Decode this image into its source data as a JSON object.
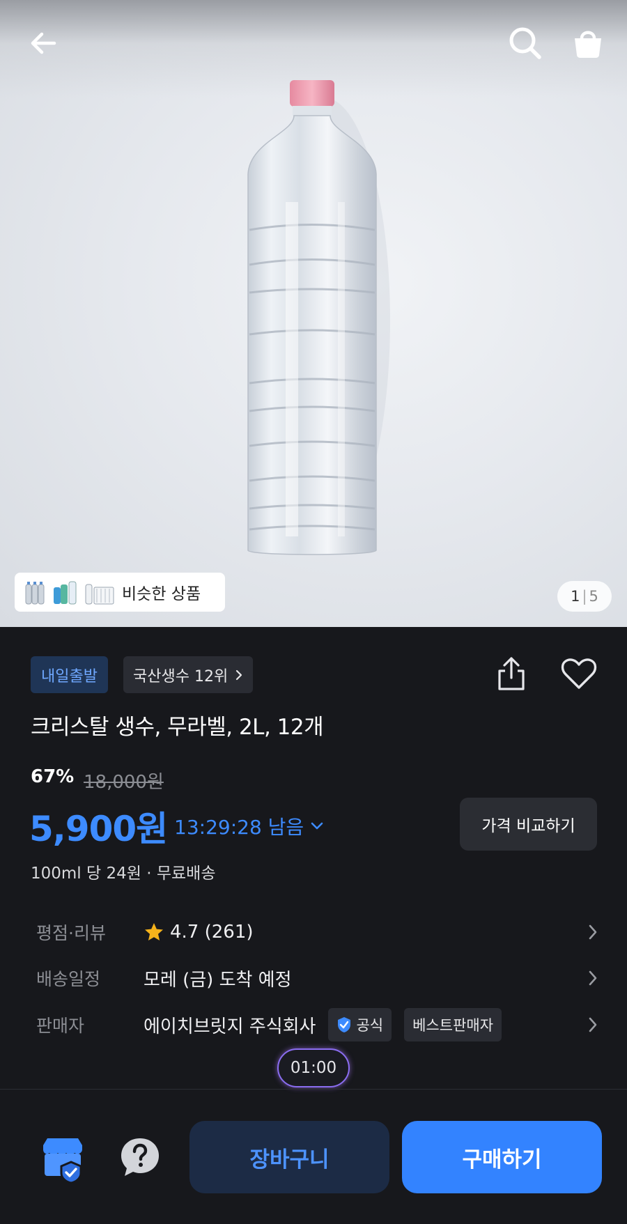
{
  "gallery": {
    "similar_label": "비슷한 상품",
    "page_current": "1",
    "page_total": "5"
  },
  "badges": {
    "delivery": "내일출발",
    "rank": "국산생수 12위"
  },
  "product": {
    "title": "크리스탈 생수, 무라벨, 2L, 12개",
    "discount": "67%",
    "original_price": "18,000원",
    "price": "5,900원",
    "timer": "13:29:28 남음",
    "compare_label": "가격 비교하기",
    "unit_info": "100ml 당 24원 · 무료배송"
  },
  "info": {
    "rating_label": "평점·리뷰",
    "rating_value": "4.7 (261)",
    "delivery_label": "배송일정",
    "delivery_value": "모레 (금) 도착 예정",
    "seller_label": "판매자",
    "seller_value": "에이치브릿지 주식회사",
    "official_tag": "공식",
    "best_tag": "베스트판매자"
  },
  "floating_time": "01:00",
  "actions": {
    "cart": "장바구니",
    "buy": "구매하기"
  },
  "colors": {
    "accent": "#3383ff",
    "price": "#3d8bff",
    "background": "#17181c",
    "star": "#f5b21b"
  }
}
